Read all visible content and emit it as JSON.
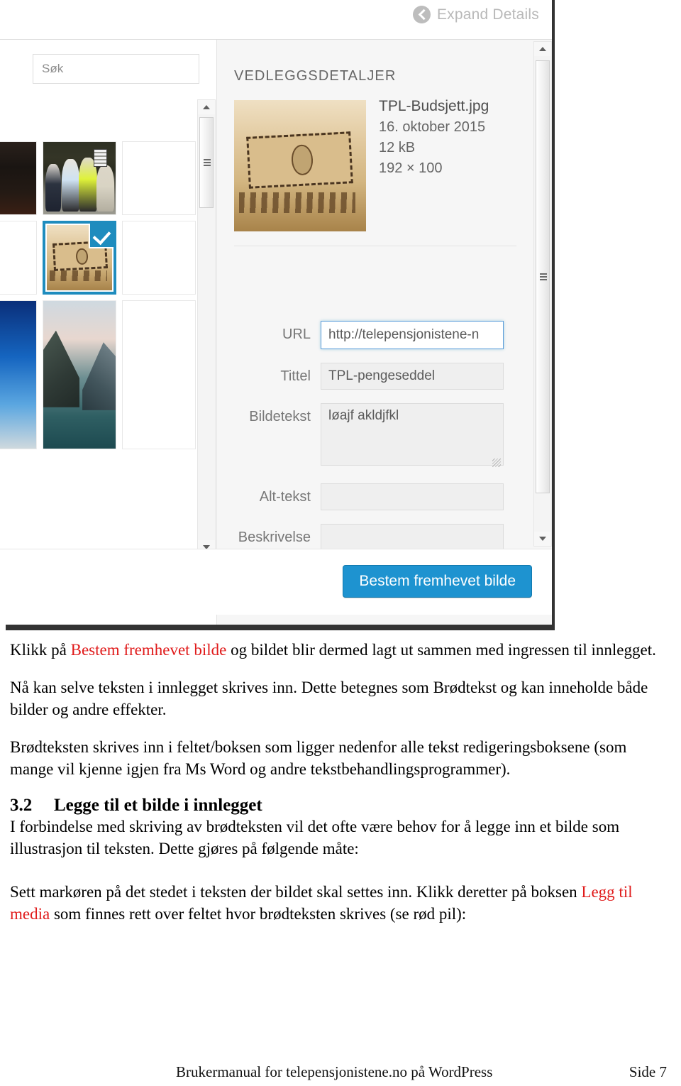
{
  "modal": {
    "header": {
      "expand_details_label": "Expand Details",
      "chevron_icon": "chevron-left-icon"
    },
    "search": {
      "placeholder": "Søk",
      "value": ""
    },
    "details": {
      "section_title": "VEDLEGGSDETALJER",
      "filename": "TPL-Budsjett.jpg",
      "date": "16. oktober 2015",
      "filesize": "12 kB",
      "dimensions": "192 × 100"
    },
    "fields": [
      {
        "label": "URL",
        "value": "http://telepensjonistene-n",
        "focused": true
      },
      {
        "label": "Tittel",
        "value": "TPL-pengeseddel",
        "focused": false
      },
      {
        "label": "Bildetekst",
        "value": "løajf akldjfkl",
        "focused": false
      },
      {
        "label": "Alt-tekst",
        "value": "",
        "focused": false
      },
      {
        "label": "Beskrivelse",
        "value": "",
        "focused": false
      }
    ],
    "primary_button": "Bestem fremhevet bilde",
    "accent_color": "#1e93d0",
    "selected_badge_icon": "checkmark-icon"
  },
  "document": {
    "p1": {
      "before": "Klikk på ",
      "highlight": "Bestem fremhevet bilde",
      "after": " og bildet blir dermed lagt ut sammen med ingressen til innlegget."
    },
    "p2": "Nå kan selve teksten i innlegget skrives inn. Dette betegnes som Brødtekst og kan inneholde både bilder og andre effekter.",
    "p3": "Brødteksten skrives inn i feltet/boksen som ligger nedenfor alle tekst redigeringsboksene (som mange vil kjenne igjen fra Ms Word og andre tekstbehandlingsprogrammer).",
    "heading": {
      "number": "3.2",
      "title": "Legge til et bilde i innlegget"
    },
    "p4": "I forbindelse med skriving av brødteksten vil det ofte være behov for å legge inn et bilde som illustrasjon til teksten. Dette gjøres på følgende måte:",
    "p5": {
      "before": "Sett markøren på det stedet i teksten der bildet skal settes inn. Klikk deretter på boksen ",
      "highlight": "Legg til media",
      "after": " som finnes rett over feltet hvor brødteksten skrives (se rød pil):"
    },
    "highlight_color": "#e01b1b"
  },
  "footer": {
    "left": "Brukermanual for telepensjonistene.no på WordPress",
    "right": "Side 7"
  }
}
